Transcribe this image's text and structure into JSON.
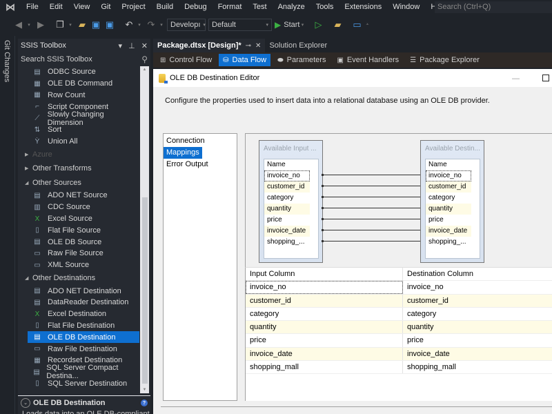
{
  "menubar": {
    "items": [
      "File",
      "Edit",
      "View",
      "Git",
      "Project",
      "Build",
      "Debug",
      "Format",
      "Test",
      "Analyze",
      "Tools",
      "Extensions",
      "Window",
      "Help"
    ],
    "search_placeholder": "Search (Ctrl+Q)"
  },
  "toolbar": {
    "config_combo": "Developı",
    "platform_combo": "Default",
    "start_label": "Start"
  },
  "git_strip": {
    "label": "Git Changes"
  },
  "toolbox": {
    "title": "SSIS Toolbox",
    "search_label": "Search SSIS Toolbox",
    "common_items": [
      {
        "label": "ODBC Source",
        "icon": "source-icon"
      },
      {
        "label": "OLE DB Command",
        "icon": "command-icon"
      },
      {
        "label": "Row Count",
        "icon": "grid-icon"
      },
      {
        "label": "Script Component",
        "icon": "script-icon"
      },
      {
        "label": "Slowly Changing Dimension",
        "icon": "dimension-icon"
      },
      {
        "label": "Sort",
        "icon": "sort-icon"
      },
      {
        "label": "Union All",
        "icon": "union-icon"
      }
    ],
    "categories": {
      "azure": "Azure",
      "other_transforms": "Other Transforms",
      "other_sources": "Other Sources",
      "other_destinations": "Other Destinations"
    },
    "source_items": [
      {
        "label": "ADO NET Source"
      },
      {
        "label": "CDC Source"
      },
      {
        "label": "Excel Source"
      },
      {
        "label": "Flat File Source"
      },
      {
        "label": "OLE DB Source"
      },
      {
        "label": "Raw File Source"
      },
      {
        "label": "XML Source"
      }
    ],
    "destination_items": [
      {
        "label": "ADO NET Destination"
      },
      {
        "label": "DataReader Destination"
      },
      {
        "label": "Excel Destination"
      },
      {
        "label": "Flat File Destination"
      },
      {
        "label": "OLE DB Destination",
        "selected": true
      },
      {
        "label": "Raw File Destination"
      },
      {
        "label": "Recordset Destination"
      },
      {
        "label": "SQL Server Compact Destina..."
      },
      {
        "label": "SQL Server Destination"
      }
    ],
    "description": {
      "title": "OLE DB Destination",
      "text": "Loads data into an OLE DB-compliant"
    }
  },
  "doc_tabs": [
    {
      "label": "Package.dtsx [Design]*",
      "active": true
    },
    {
      "label": "Solution Explorer",
      "active": false
    }
  ],
  "designer_tabs": [
    {
      "label": "Control Flow",
      "active": false
    },
    {
      "label": "Data Flow",
      "active": true
    },
    {
      "label": "Parameters",
      "active": false
    },
    {
      "label": "Event Handlers",
      "active": false
    },
    {
      "label": "Package Explorer",
      "active": false
    }
  ],
  "editor": {
    "title": "OLE DB Destination Editor",
    "description": "Configure the properties used to insert data into a relational database using an OLE DB provider.",
    "nav": [
      "Connection Manager",
      "Mappings",
      "Error Output"
    ],
    "nav_selected": "Mappings",
    "input_box": {
      "title": "Available Input ...",
      "header": "Name",
      "columns": [
        "invoice_no",
        "customer_id",
        "category",
        "quantity",
        "price",
        "invoice_date",
        "shopping_..."
      ]
    },
    "dest_box": {
      "title": "Available Destin...",
      "header": "Name",
      "columns": [
        "invoice_no",
        "customer_id",
        "category",
        "quantity",
        "price",
        "invoice_date",
        "shopping_..."
      ]
    },
    "grid": {
      "headers": [
        "Input Column",
        "Destination Column"
      ],
      "rows": [
        [
          "invoice_no",
          "invoice_no"
        ],
        [
          "customer_id",
          "customer_id"
        ],
        [
          "category",
          "category"
        ],
        [
          "quantity",
          "quantity"
        ],
        [
          "price",
          "price"
        ],
        [
          "invoice_date",
          "invoice_date"
        ],
        [
          "shopping_mall",
          "shopping_mall"
        ]
      ]
    }
  }
}
